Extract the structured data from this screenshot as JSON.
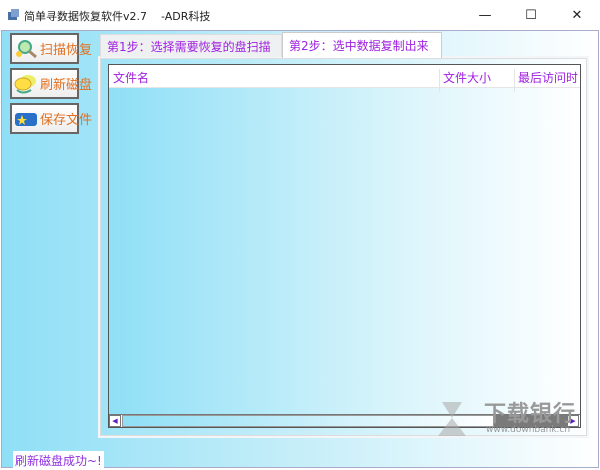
{
  "window": {
    "title": "简单寻数据恢复软件v2.7    -ADR科技",
    "minimize": "—",
    "maximize": "☐",
    "close": "✕"
  },
  "sidebar": {
    "items": [
      {
        "label": "扫描恢复",
        "icon": "magnifier-icon"
      },
      {
        "label": "刷新磁盘",
        "icon": "disks-icon"
      },
      {
        "label": "保存文件",
        "icon": "save-folder-icon"
      }
    ]
  },
  "tabs": [
    {
      "label": "第1步：选择需要恢复的盘扫描",
      "active": false
    },
    {
      "label": "第2步：选中数据复制出来",
      "active": true
    }
  ],
  "list": {
    "columns": [
      "文件名",
      "文件大小",
      "最后访问时"
    ],
    "rows": []
  },
  "scrollbar": {
    "left": "◀",
    "right": "▶"
  },
  "status": "刷新磁盘成功~!",
  "watermark": {
    "text": "下载银行",
    "url": "www.downbank.cn"
  },
  "colors": {
    "accent": "#a020e0",
    "button_text": "#e07020"
  }
}
